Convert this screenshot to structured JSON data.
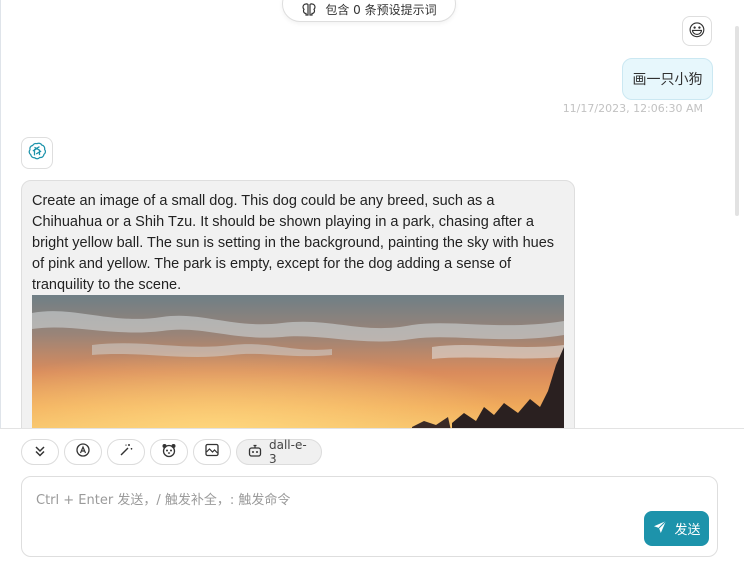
{
  "prompt_pill": {
    "label": "包含 0 条预设提示词",
    "icon": "brain-icon"
  },
  "user_message": {
    "avatar": "😃",
    "text": "画一只小狗",
    "timestamp": "11/17/2023, 12:06:30 AM"
  },
  "bot_message": {
    "avatar": "openai-icon",
    "text": "Create an image of a small dog. This dog could be any breed, such as a Chihuahua or a Shih Tzu. It should be shown playing in a park, chasing after a bright yellow ball. The sun is setting in the background, painting the sky with hues of pink and yellow. The park is empty, except for the dog adding a sense of tranquility to the scene.",
    "image": "generated-sunset-image"
  },
  "actions": [
    {
      "icon": "chevrons-down-icon"
    },
    {
      "icon": "theme-auto-icon"
    },
    {
      "icon": "magic-wand-icon"
    },
    {
      "icon": "mask-icon"
    },
    {
      "icon": "image-icon"
    }
  ],
  "model_label": "dall-e-3",
  "input": {
    "placeholder": "Ctrl + Enter 发送，/ 触发补全，: 触发命令",
    "value": ""
  },
  "send_label": "发送",
  "colors": {
    "accent": "#1d93ab",
    "user_bubble": "#e7f7fc",
    "bot_bubble": "#f1f1f1"
  }
}
